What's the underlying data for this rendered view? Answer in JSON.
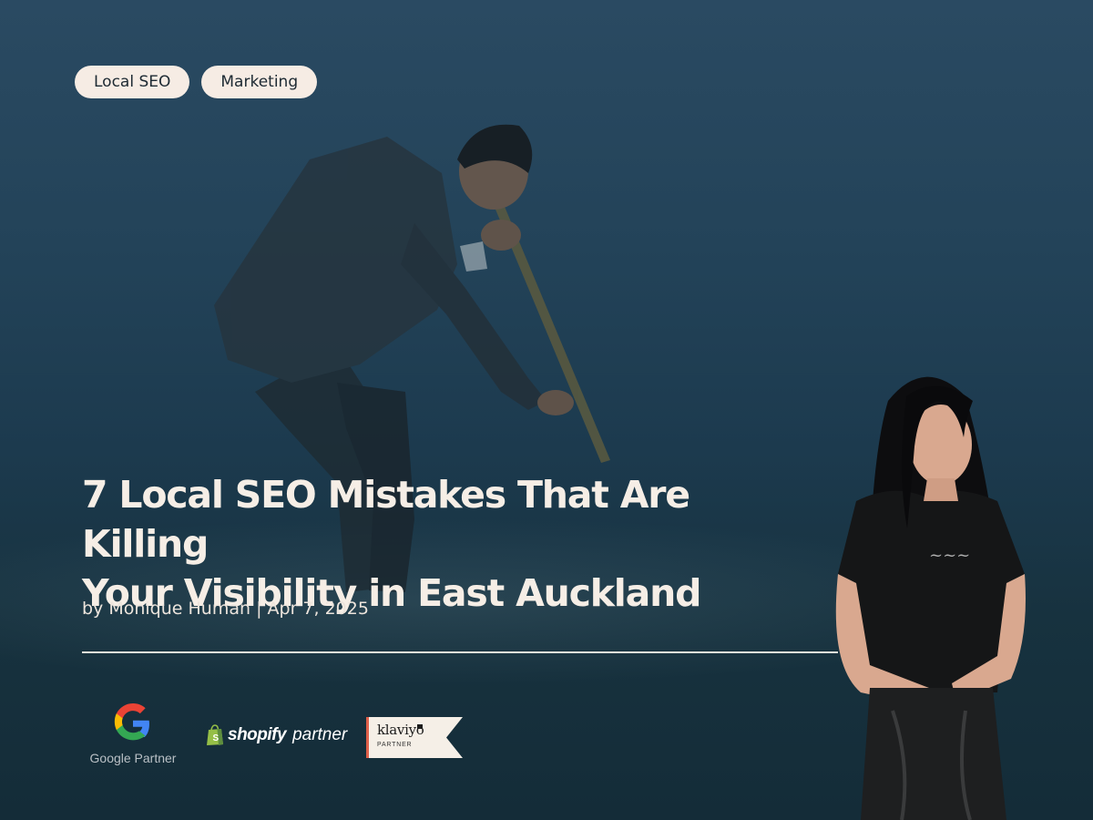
{
  "tags": [
    "Local SEO",
    "Marketing"
  ],
  "article": {
    "title_line1": "7 Local SEO Mistakes That Are Killing",
    "title_line2": "Your Visibility in East Auckland",
    "byline": "by Monique Human | Apr 7, 2025"
  },
  "partners": {
    "google_caption": "Google Partner",
    "shopify_word": "shopify",
    "shopify_suffix": "partner",
    "klaviyo_word": "klaviyo",
    "klaviyo_sub": "PARTNER"
  },
  "colors": {
    "background_top": "#2a4a62",
    "background_bottom": "#142c38",
    "tag_bg": "#f6ece4",
    "title_text": "#f6eee6",
    "shopify_green": "#95bf47",
    "klaviyo_accent": "#e0604a"
  },
  "icons": {
    "google": "google-g-icon",
    "shopify": "shopify-bag-icon"
  }
}
